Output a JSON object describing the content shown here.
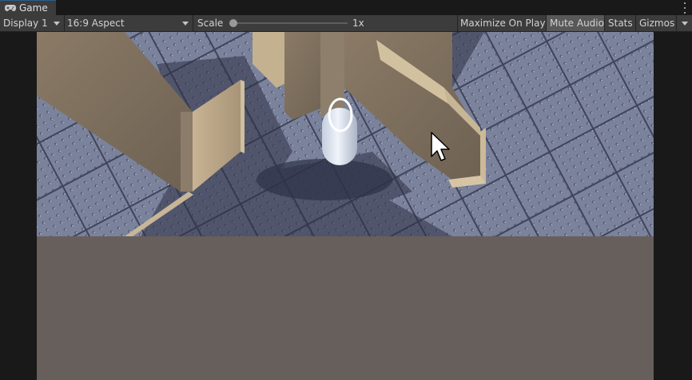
{
  "tab": {
    "label": "Game",
    "icon": "gamepad-icon"
  },
  "toolbar": {
    "display": "Display 1",
    "aspect": "16:9 Aspect",
    "scale_label": "Scale",
    "scale_value_text": "1x",
    "scale_slider_fraction": 0.0,
    "maximize_on_play": "Maximize On Play",
    "mute_audio": "Mute Audio",
    "stats": "Stats",
    "gizmos": "Gizmos"
  },
  "colors": {
    "panel": "#3c3c3c",
    "background": "#191919",
    "toggle_active": "#585858",
    "letterbox_fill": "#675f5b",
    "floor": "#6f7590"
  },
  "scene": {
    "description_icons": [
      "arrow-cursor-icon"
    ]
  }
}
